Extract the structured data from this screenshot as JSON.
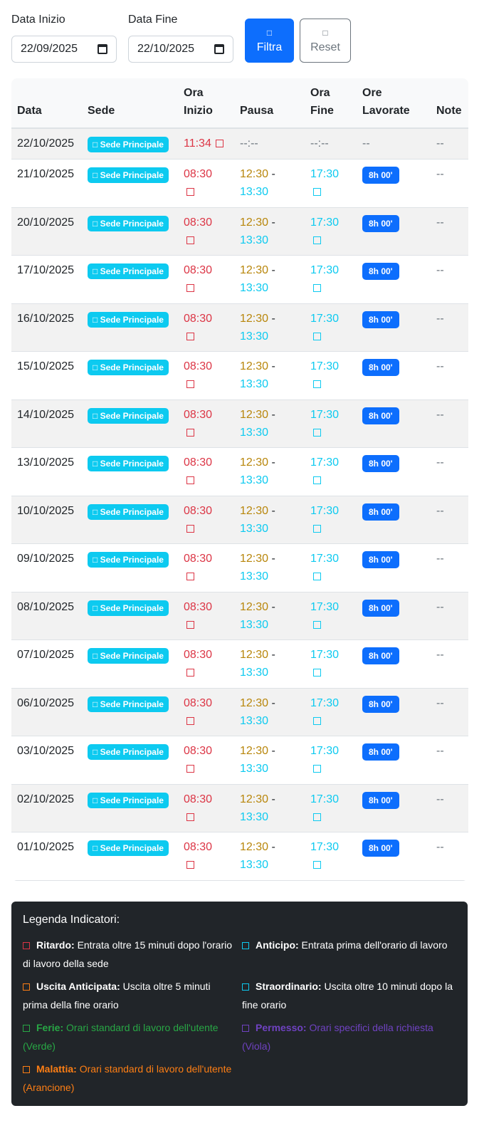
{
  "filters": {
    "start_label": "Data Inizio",
    "start_value": "22/09/2025",
    "end_label": "Data Fine",
    "end_value": "22/10/2025",
    "filter_button": "Filtra",
    "reset_button": "Reset",
    "button_icon": "□"
  },
  "table": {
    "headers": [
      "Data",
      "Sede",
      "Ora Inizio",
      "Pausa",
      "Ora Fine",
      "Ore Lavorate",
      "Note"
    ],
    "sede_label": "□ Sede Principale",
    "first_row": {
      "date": "22/10/2025",
      "start": "11:34",
      "pause": "--:--",
      "end": "--:--",
      "hours": "--",
      "note": "--"
    },
    "rows": [
      {
        "date": "21/10/2025",
        "start": "08:30",
        "pause_start": "12:30",
        "pause_end": "13:30",
        "end": "17:30",
        "hours": "8h 00'",
        "note": "--"
      },
      {
        "date": "20/10/2025",
        "start": "08:30",
        "pause_start": "12:30",
        "pause_end": "13:30",
        "end": "17:30",
        "hours": "8h 00'",
        "note": "--"
      },
      {
        "date": "17/10/2025",
        "start": "08:30",
        "pause_start": "12:30",
        "pause_end": "13:30",
        "end": "17:30",
        "hours": "8h 00'",
        "note": "--"
      },
      {
        "date": "16/10/2025",
        "start": "08:30",
        "pause_start": "12:30",
        "pause_end": "13:30",
        "end": "17:30",
        "hours": "8h 00'",
        "note": "--"
      },
      {
        "date": "15/10/2025",
        "start": "08:30",
        "pause_start": "12:30",
        "pause_end": "13:30",
        "end": "17:30",
        "hours": "8h 00'",
        "note": "--"
      },
      {
        "date": "14/10/2025",
        "start": "08:30",
        "pause_start": "12:30",
        "pause_end": "13:30",
        "end": "17:30",
        "hours": "8h 00'",
        "note": "--"
      },
      {
        "date": "13/10/2025",
        "start": "08:30",
        "pause_start": "12:30",
        "pause_end": "13:30",
        "end": "17:30",
        "hours": "8h 00'",
        "note": "--"
      },
      {
        "date": "10/10/2025",
        "start": "08:30",
        "pause_start": "12:30",
        "pause_end": "13:30",
        "end": "17:30",
        "hours": "8h 00'",
        "note": "--"
      },
      {
        "date": "09/10/2025",
        "start": "08:30",
        "pause_start": "12:30",
        "pause_end": "13:30",
        "end": "17:30",
        "hours": "8h 00'",
        "note": "--"
      },
      {
        "date": "08/10/2025",
        "start": "08:30",
        "pause_start": "12:30",
        "pause_end": "13:30",
        "end": "17:30",
        "hours": "8h 00'",
        "note": "--"
      },
      {
        "date": "07/10/2025",
        "start": "08:30",
        "pause_start": "12:30",
        "pause_end": "13:30",
        "end": "17:30",
        "hours": "8h 00'",
        "note": "--"
      },
      {
        "date": "06/10/2025",
        "start": "08:30",
        "pause_start": "12:30",
        "pause_end": "13:30",
        "end": "17:30",
        "hours": "8h 00'",
        "note": "--"
      },
      {
        "date": "03/10/2025",
        "start": "08:30",
        "pause_start": "12:30",
        "pause_end": "13:30",
        "end": "17:30",
        "hours": "8h 00'",
        "note": "--"
      },
      {
        "date": "02/10/2025",
        "start": "08:30",
        "pause_start": "12:30",
        "pause_end": "13:30",
        "end": "17:30",
        "hours": "8h 00'",
        "note": "--"
      },
      {
        "date": "01/10/2025",
        "start": "08:30",
        "pause_start": "12:30",
        "pause_end": "13:30",
        "end": "17:30",
        "hours": "8h 00'",
        "note": "--"
      }
    ],
    "pause_separator": " -"
  },
  "legend": {
    "title": "Legenda Indicatori:",
    "items": [
      {
        "label": "Ritardo:",
        "text": "Entrata oltre 15 minuti dopo l'orario di lavoro della sede"
      },
      {
        "label": "Anticipo:",
        "text": "Entrata prima dell'orario di lavoro"
      },
      {
        "label": "Uscita Anticipata:",
        "text": "Uscita oltre 5 minuti prima della fine orario"
      },
      {
        "label": "Straordinario:",
        "text": "Uscita oltre 10 minuti dopo la fine orario"
      },
      {
        "label": "Ferie:",
        "text": "Orari standard di lavoro dell'utente (Verde)"
      },
      {
        "label": "Permesso:",
        "text": "Orari specifici della richiesta (Viola)"
      },
      {
        "label": "Malattia:",
        "text": "Orari standard di lavoro dell'utente (Arancione)"
      }
    ]
  },
  "colors": {
    "primary": "#0d6efd",
    "info": "#0dcaf0",
    "danger": "#dc3545",
    "warning": "#b8860b",
    "legend_bg": "#212529"
  }
}
